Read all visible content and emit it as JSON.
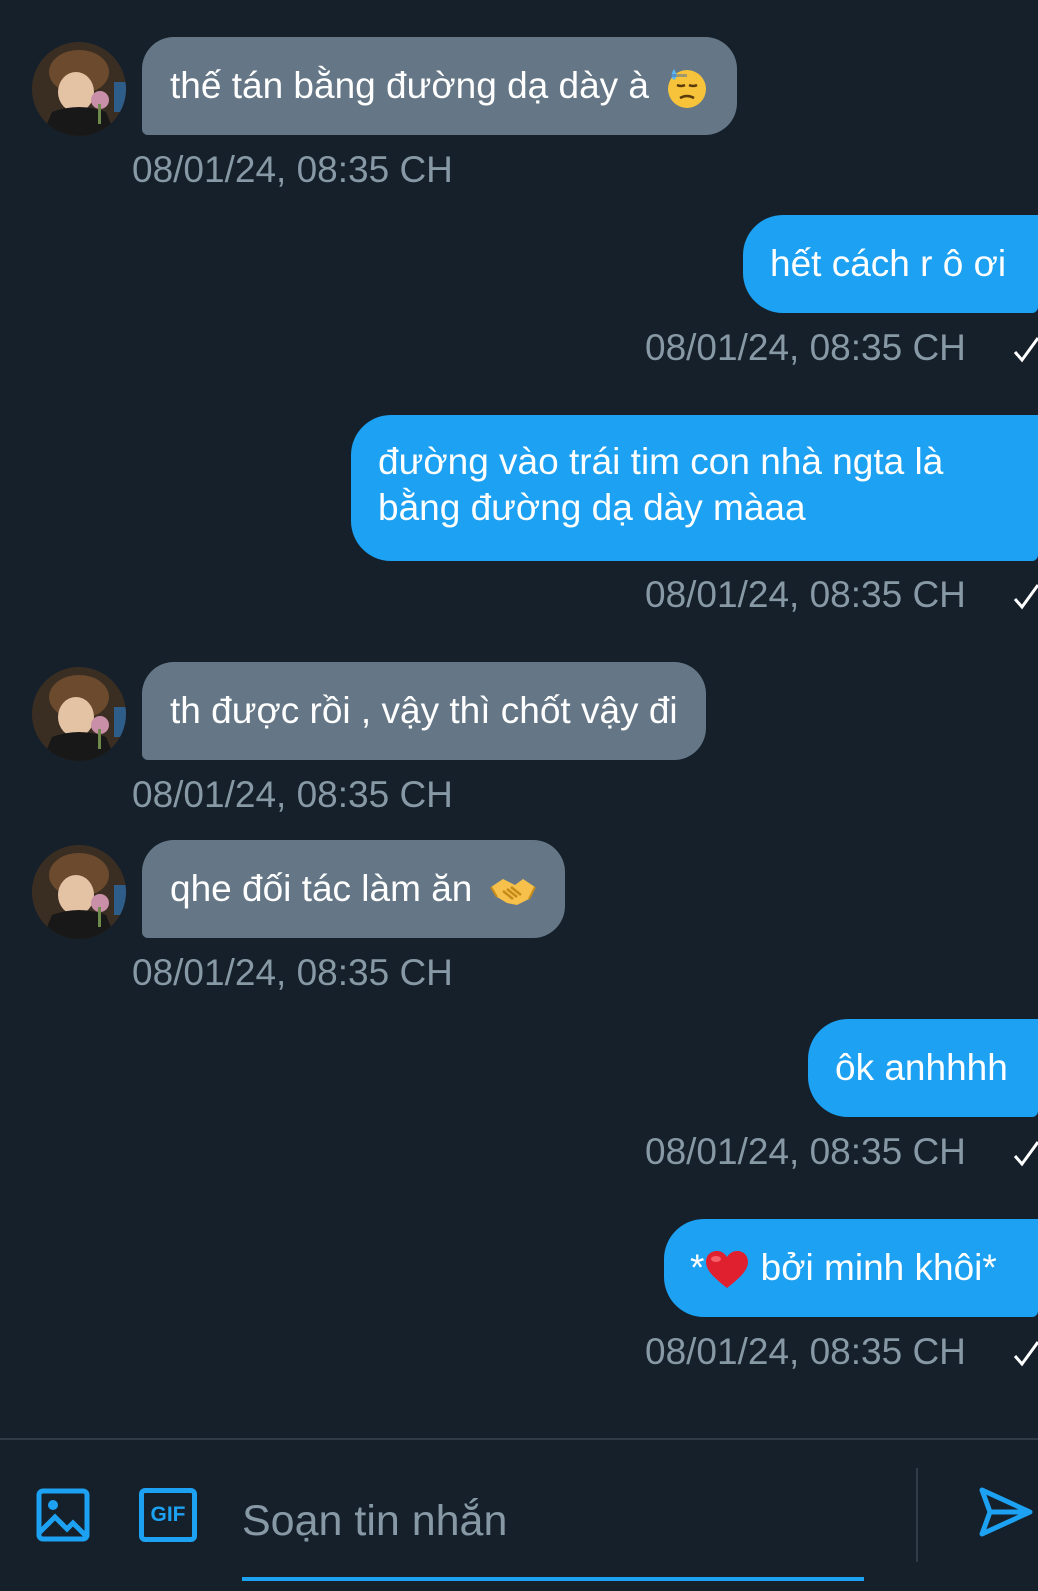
{
  "colors": {
    "background": "#15202b",
    "incoming_bubble": "#657786",
    "outgoing_bubble": "#1da1f2",
    "timestamp": "#8899a6",
    "accent": "#1da1f2"
  },
  "messages": [
    {
      "direction": "incoming",
      "text": "thế tán bằng đường dạ dày à",
      "emoji": "downcast-sweat-face-emoji",
      "timestamp": "08/01/24, 08:35 CH",
      "has_avatar": true
    },
    {
      "direction": "outgoing",
      "text": "hết cách r ô ơi",
      "timestamp": "08/01/24, 08:35 CH",
      "sent_check": true
    },
    {
      "direction": "outgoing",
      "text": "đường vào trái tim con nhà ngta là bằng đường dạ dày màaa",
      "timestamp": "08/01/24, 08:35 CH",
      "sent_check": true
    },
    {
      "direction": "incoming",
      "text": "th được rồi , vậy thì chốt vậy đi",
      "timestamp": "08/01/24, 08:35 CH",
      "has_avatar": true
    },
    {
      "direction": "incoming",
      "text": "qhe đối tác làm ăn",
      "emoji": "handshake-emoji",
      "timestamp": "08/01/24, 08:35 CH",
      "has_avatar": true
    },
    {
      "direction": "outgoing",
      "text": "ôk anhhhh",
      "timestamp": "08/01/24, 08:35 CH",
      "sent_check": true
    },
    {
      "direction": "outgoing",
      "text_before": "*",
      "emoji": "red-heart-emoji",
      "text_after": " bởi minh khôi*",
      "timestamp": "08/01/24, 08:35 CH",
      "sent_check": true
    }
  ],
  "composer": {
    "image_icon": "image-icon",
    "gif_icon": "gif-icon",
    "gif_label": "GIF",
    "placeholder": "Soạn tin nhắn",
    "send_icon": "send-icon"
  }
}
